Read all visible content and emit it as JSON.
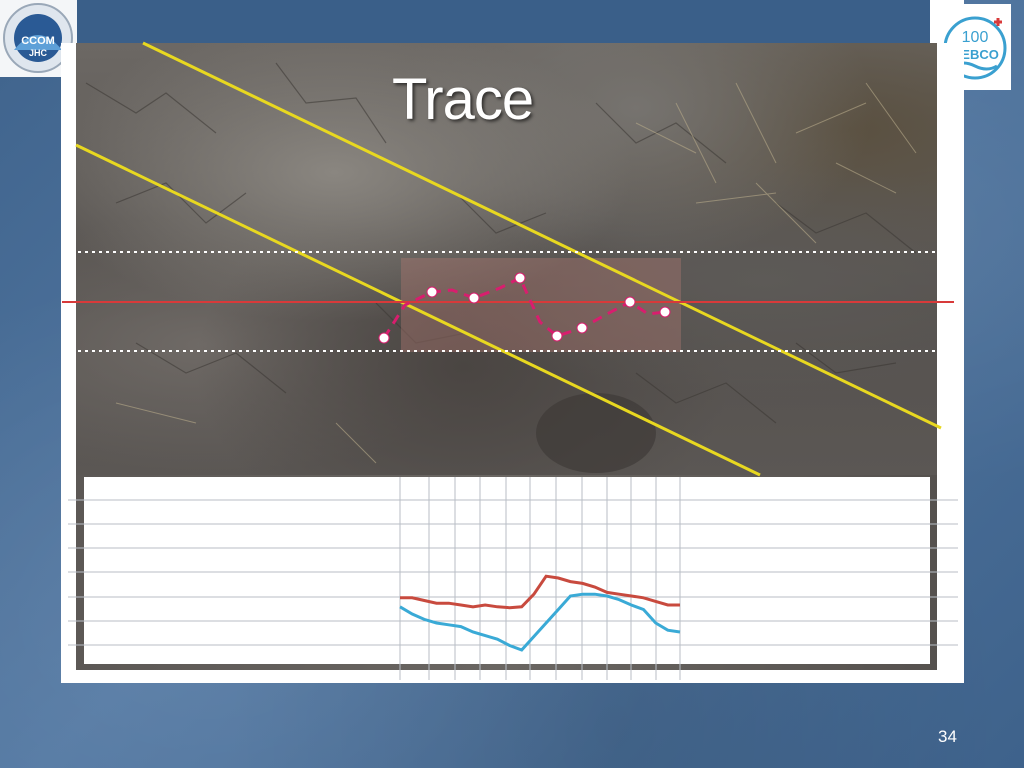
{
  "slide": {
    "title": "Trace",
    "page_number": "34"
  },
  "logos": {
    "left": {
      "name": "ccom-jhc-logo",
      "text": "CCOM JHC"
    },
    "right": {
      "name": "gebco-100-logo",
      "text": "GEBCO"
    }
  },
  "colors": {
    "background": "#4a6e96",
    "guide_line": "#e8d820",
    "trace_line": "#d83a3a",
    "profile_red": "#c84a3e",
    "profile_blue": "#3aaad6",
    "trace_dots": "#d81e6e"
  },
  "chart_data": {
    "type": "line",
    "title": "",
    "xlabel": "",
    "ylabel": "",
    "x": [
      0,
      1,
      2,
      3,
      4,
      5,
      6,
      7,
      8,
      9,
      10,
      11,
      12,
      13,
      14,
      15,
      16,
      17,
      18,
      19,
      20,
      21,
      22,
      23
    ],
    "series": [
      {
        "color": "#c84a3e",
        "values": [
          0.58,
          0.58,
          0.55,
          0.52,
          0.52,
          0.5,
          0.48,
          0.5,
          0.48,
          0.47,
          0.48,
          0.62,
          0.82,
          0.8,
          0.76,
          0.74,
          0.7,
          0.64,
          0.62,
          0.6,
          0.58,
          0.54,
          0.5,
          0.5
        ]
      },
      {
        "color": "#3aaad6",
        "values": [
          0.48,
          0.4,
          0.34,
          0.3,
          0.28,
          0.26,
          0.2,
          0.16,
          0.12,
          0.05,
          0.0,
          0.15,
          0.3,
          0.45,
          0.6,
          0.62,
          0.62,
          0.6,
          0.56,
          0.5,
          0.45,
          0.3,
          0.22,
          0.2
        ]
      }
    ],
    "grid": true
  }
}
